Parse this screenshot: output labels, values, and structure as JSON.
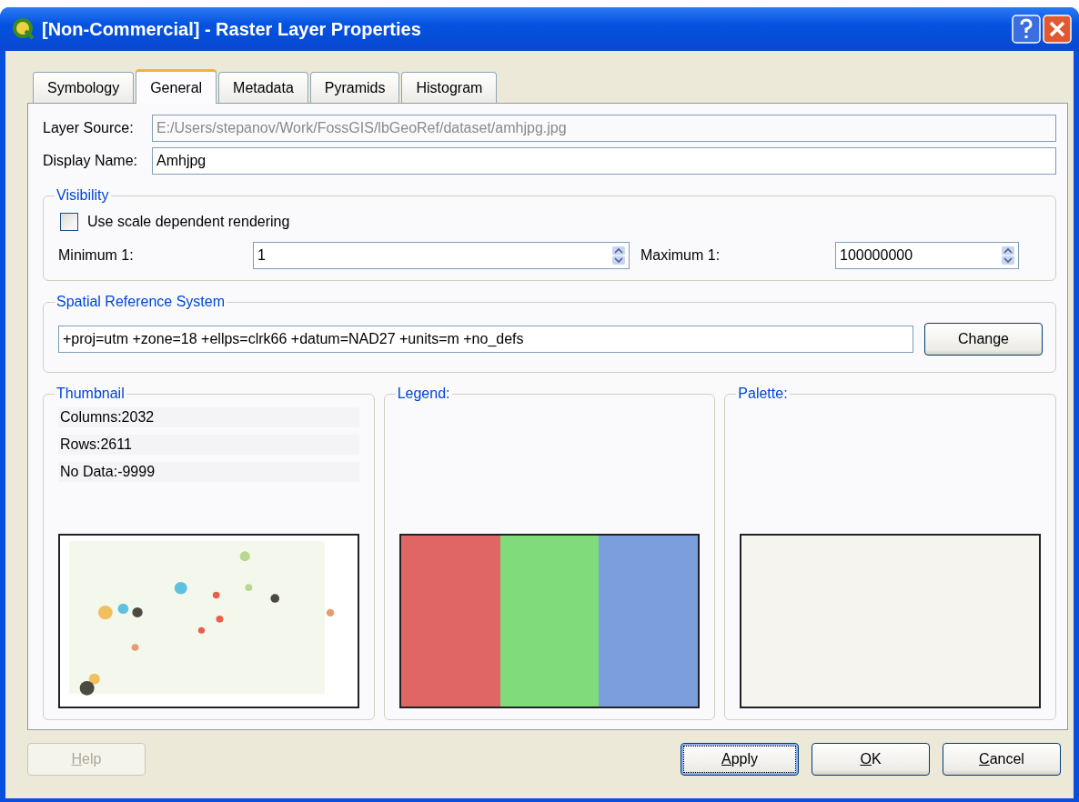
{
  "window": {
    "title": "[Non-Commercial] - Raster Layer Properties"
  },
  "tabs": [
    {
      "label": "Symbology",
      "selected": false
    },
    {
      "label": "General",
      "selected": true
    },
    {
      "label": "Metadata",
      "selected": false
    },
    {
      "label": "Pyramids",
      "selected": false
    },
    {
      "label": "Histogram",
      "selected": false
    }
  ],
  "layer_source": {
    "label": "Layer Source:",
    "value": "E:/Users/stepanov/Work/FossGIS/lbGeoRef/dataset/amhjpg.jpg",
    "disabled": true
  },
  "display_name": {
    "label": "Display Name:",
    "value": "Amhjpg",
    "disabled": false
  },
  "visibility": {
    "title": "Visibility",
    "checkbox": {
      "label": "Use scale dependent rendering",
      "checked": false
    },
    "minimum": {
      "label": "Minimum 1:",
      "value": "1"
    },
    "maximum": {
      "label": "Maximum 1:",
      "value": "100000000"
    }
  },
  "spatial_reference_system": {
    "title": "Spatial Reference System",
    "value": "+proj=utm +zone=18 +ellps=clrk66 +datum=NAD27 +units=m +no_defs",
    "button": "Change"
  },
  "thumbnail": {
    "title": "Thumbnail",
    "info": [
      "Columns:2032",
      "Rows:2611",
      "No Data:-9999"
    ]
  },
  "legend": {
    "title": "Legend:",
    "bands": [
      {
        "color": "#e06666"
      },
      {
        "color": "#80dc7a"
      },
      {
        "color": "#7b9fdc"
      }
    ]
  },
  "palette": {
    "title": "Palette:"
  },
  "buttons": [
    {
      "label": "Help",
      "disabled": true,
      "focused": false
    },
    {
      "label": "Apply",
      "disabled": false,
      "focused": true
    },
    {
      "label": "OK",
      "disabled": false,
      "focused": false
    },
    {
      "label": "Cancel",
      "disabled": false,
      "focused": false
    }
  ]
}
